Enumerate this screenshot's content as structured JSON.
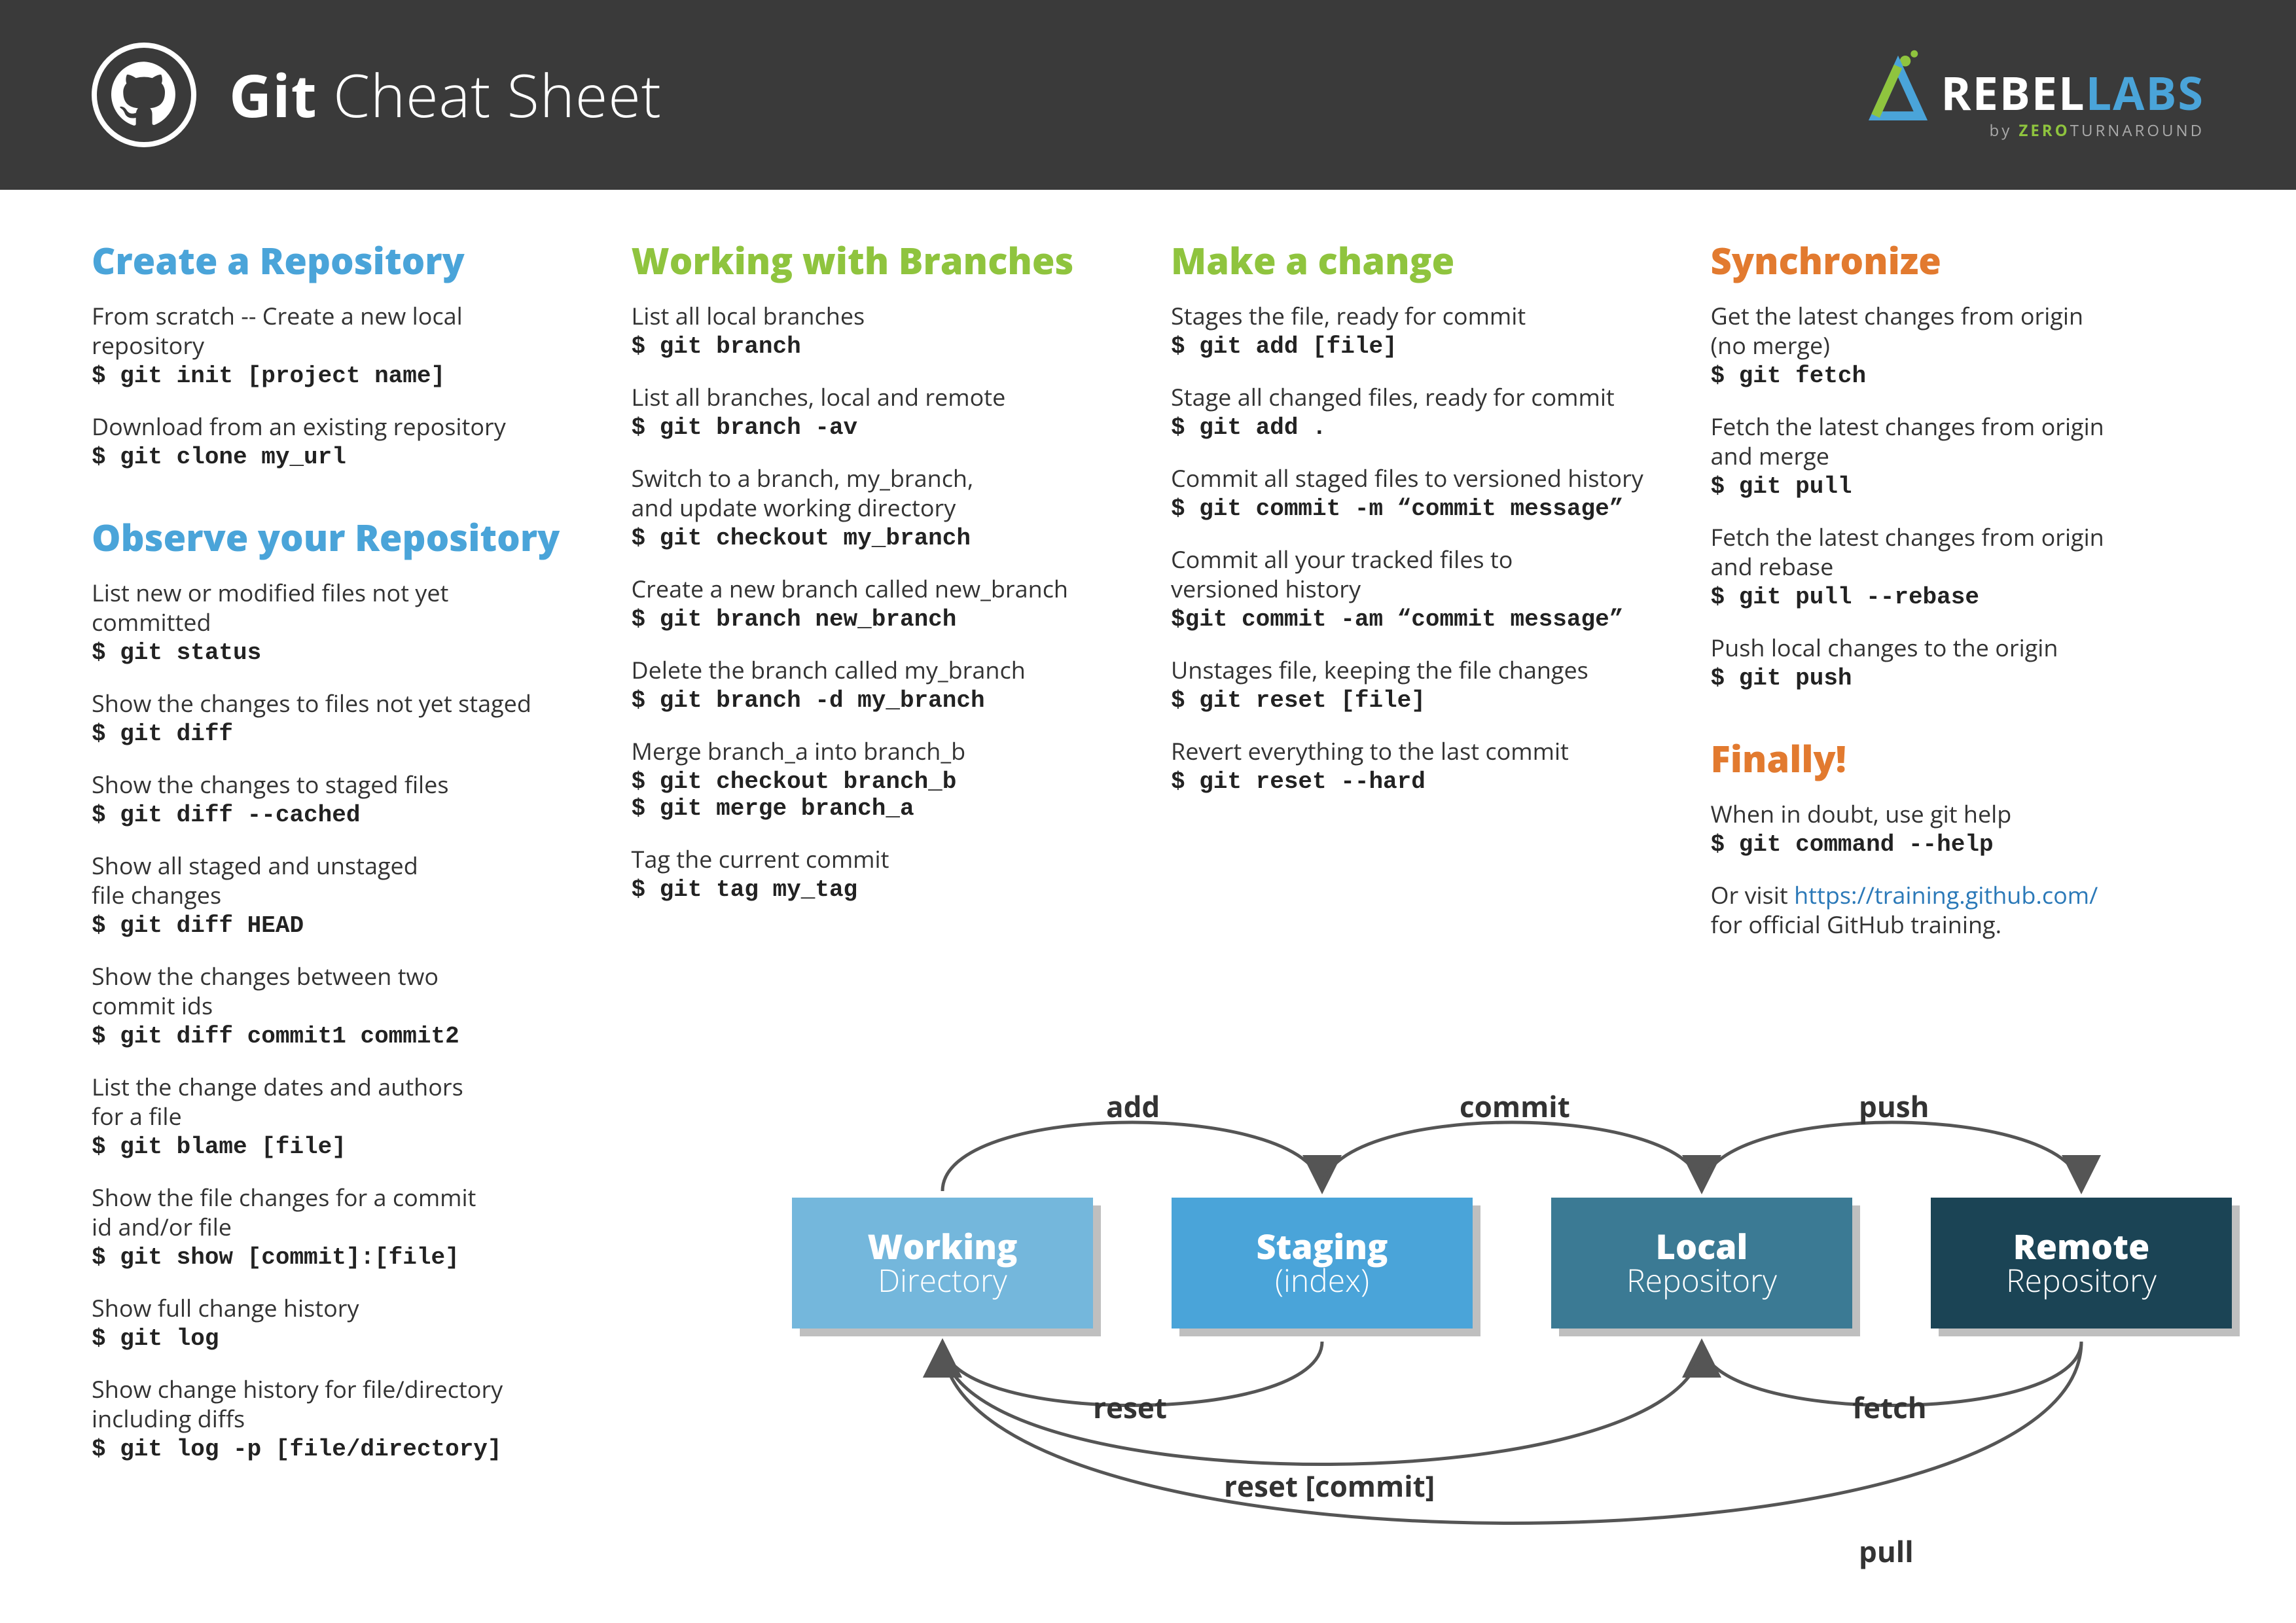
{
  "header": {
    "title_bold": "Git",
    "title_light": " Cheat Sheet",
    "logo_rebel": "REBEL",
    "logo_labs": "LABS",
    "logo_by": "by ",
    "logo_zero": "ZERO",
    "logo_turn": "TURNAROUND"
  },
  "col1": {
    "h1": "Create a Repository",
    "i1d": "From scratch -- Create a new local\nrepository",
    "i1c": "$ git init [project name]",
    "i2d": "Download from an existing repository",
    "i2c": "$ git clone my_url",
    "h2": "Observe your Repository",
    "i3d": "List new or modified files not yet\ncommitted",
    "i3c": "$ git status",
    "i4d": "Show the changes to files not yet staged",
    "i4c": "$ git diff",
    "i5d": "Show the changes to staged files",
    "i5c": "$ git diff --cached",
    "i6d": "Show all staged and unstaged\nfile changes",
    "i6c": "$ git diff HEAD",
    "i7d": "Show the changes between two\ncommit ids",
    "i7c": "$ git diff commit1 commit2",
    "i8d": "List the change dates and authors\nfor a file",
    "i8c": "$ git blame [file]",
    "i9d": "Show the file changes for a commit\nid and/or file",
    "i9c": "$ git show [commit]:[file]",
    "i10d": "Show full change history",
    "i10c": "$ git log",
    "i11d": "Show change history for file/directory\nincluding diffs",
    "i11c": "$ git log -p [file/directory]"
  },
  "col2": {
    "h1": "Working with Branches",
    "i1d": "List all local branches",
    "i1c": "$ git branch",
    "i2d": "List all branches, local and remote",
    "i2c": "$ git branch -av",
    "i3d": "Switch to a branch, my_branch,\nand update working directory",
    "i3c": "$ git checkout my_branch",
    "i4d": "Create a new branch called new_branch",
    "i4c": "$ git branch new_branch",
    "i5d": "Delete the branch called my_branch",
    "i5c": "$ git branch -d my_branch",
    "i6d": "Merge branch_a into branch_b",
    "i6c": "$ git checkout branch_b\n$ git merge branch_a",
    "i7d": "Tag the current commit",
    "i7c": "$ git tag my_tag"
  },
  "col3": {
    "h1": "Make a change",
    "i1d": "Stages the file, ready for commit",
    "i1c": "$ git add [file]",
    "i2d": "Stage all changed files, ready for commit",
    "i2c": "$ git add .",
    "i3d": "Commit all staged files to versioned history",
    "i3c": "$ git commit -m “commit message”",
    "i4d": "Commit all your tracked files to\nversioned history",
    "i4c": "$git commit -am “commit message”",
    "i5d": "Unstages file, keeping the file changes",
    "i5c": "$ git reset [file]",
    "i6d": "Revert everything to the last commit",
    "i6c": "$ git reset --hard"
  },
  "col4": {
    "h1": "Synchronize",
    "i1d": "Get the latest changes from origin\n(no merge)",
    "i1c": "$ git fetch",
    "i2d": "Fetch the latest changes from origin\nand merge",
    "i2c": "$ git pull",
    "i3d": "Fetch the latest changes from origin\nand rebase",
    "i3c": "$ git pull --rebase",
    "i4d": "Push local changes to the origin",
    "i4c": "$ git push",
    "h2": "Finally!",
    "i5d": "When in doubt, use git help",
    "i5c": "$ git command --help",
    "i6a": "Or visit ",
    "i6link": "https://training.github.com/",
    "i6b": "for official GitHub training."
  },
  "diagram": {
    "b1t": "Working",
    "b1s": "Directory",
    "b2t": "Staging",
    "b2s": "(index)",
    "b3t": "Local",
    "b3s": "Repository",
    "b4t": "Remote",
    "b4s": "Repository",
    "l_add": "add",
    "l_commit": "commit",
    "l_push": "push",
    "l_reset": "reset",
    "l_fetch": "fetch",
    "l_resetc": "reset [commit]",
    "l_pull": "pull"
  }
}
